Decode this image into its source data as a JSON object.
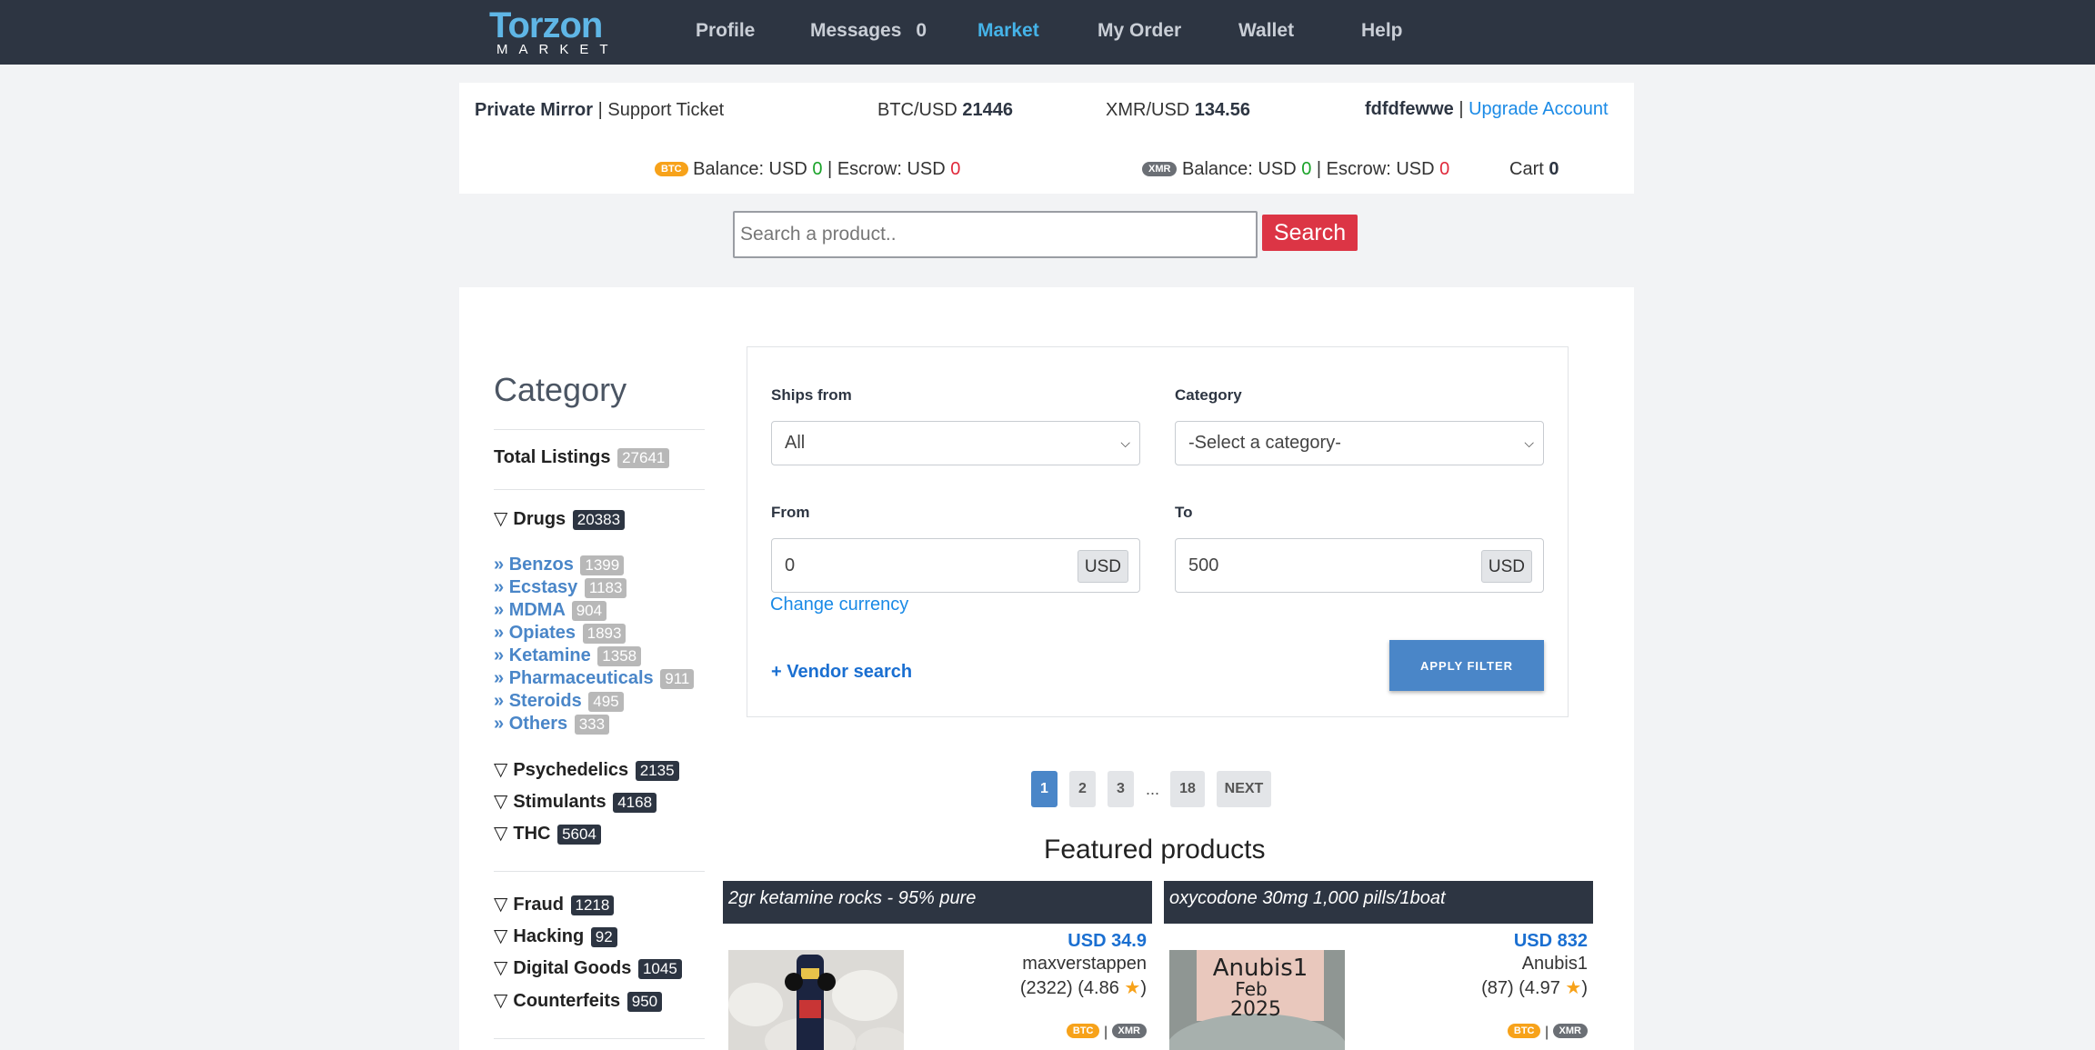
{
  "nav": {
    "logo_main": "Torzon",
    "logo_sub": "MARKET",
    "items": [
      {
        "label": "Profile"
      },
      {
        "label": "Messages"
      },
      {
        "label": "Market"
      },
      {
        "label": "My Order"
      },
      {
        "label": "Wallet"
      },
      {
        "label": "Help"
      }
    ],
    "messages_count": "0",
    "active_color": "#45b3e8"
  },
  "header": {
    "private_mirror": "Private Mirror",
    "separator": "|",
    "support_ticket": "Support Ticket",
    "btc_label": "BTC/USD",
    "btc_value": "21446",
    "xmr_label": "XMR/USD",
    "xmr_value": "134.56",
    "username": "fdfdfewwe",
    "upgrade": "Upgrade Account",
    "btc_badge": "BTC",
    "xmr_badge": "XMR",
    "balance_label": "Balance: USD",
    "escrow_label": "Escrow: USD",
    "btc_balance": "0",
    "btc_escrow": "0",
    "xmr_balance": "0",
    "xmr_escrow": "0",
    "cart_label": "Cart",
    "cart_count": "0"
  },
  "search": {
    "placeholder": "Search a product..",
    "button": "Search"
  },
  "sidebar": {
    "title": "Category",
    "total_label": "Total Listings",
    "total_count": "27641",
    "triangle": "▽",
    "subarrow": "»",
    "drugs": {
      "label": "Drugs",
      "count": "20383"
    },
    "drug_subs": [
      {
        "label": "Benzos",
        "count": "1399"
      },
      {
        "label": "Ecstasy",
        "count": "1183"
      },
      {
        "label": "MDMA",
        "count": "904"
      },
      {
        "label": "Opiates",
        "count": "1893"
      },
      {
        "label": "Ketamine",
        "count": "1358"
      },
      {
        "label": "Pharmaceuticals",
        "count": "911"
      },
      {
        "label": "Steroids",
        "count": "495"
      },
      {
        "label": "Others",
        "count": "333"
      }
    ],
    "group2": [
      {
        "label": "Psychedelics",
        "count": "2135"
      },
      {
        "label": "Stimulants",
        "count": "4168"
      },
      {
        "label": "THC",
        "count": "5604"
      }
    ],
    "group3": [
      {
        "label": "Fraud",
        "count": "1218"
      },
      {
        "label": "Hacking",
        "count": "92"
      },
      {
        "label": "Digital Goods",
        "count": "1045"
      },
      {
        "label": "Counterfeits",
        "count": "950"
      }
    ]
  },
  "filter": {
    "ships_from_label": "Ships from",
    "ships_from_value": "All",
    "category_label": "Category",
    "category_value": "-Select a category-",
    "from_label": "From",
    "from_value": "0",
    "to_label": "To",
    "to_value": "500",
    "unit": "USD",
    "change_currency": "Change currency",
    "vendor_search": "+ Vendor search",
    "apply": "APPLY FILTER"
  },
  "pagination": {
    "pages": [
      "1",
      "2",
      "3",
      "18"
    ],
    "dots": "...",
    "next": "NEXT",
    "current": "1"
  },
  "featured": {
    "title": "Featured products",
    "products": [
      {
        "title": "2gr ketamine rocks - 95% pure",
        "price": "USD 34.9",
        "vendor": "maxverstappen",
        "rating_prefix": "(2322) (4.86",
        "rating_suffix": ")"
      },
      {
        "title": "oxycodone 30mg 1,000 pills/1boat",
        "price": "USD 832",
        "vendor": "Anubis1",
        "rating_prefix": "(87) (4.97",
        "rating_suffix": ")",
        "image_text_1": "Anubis1",
        "image_text_2": "Feb",
        "image_text_3": "2025"
      }
    ],
    "star": "★",
    "btc_badge": "BTC",
    "xmr_badge": "XMR",
    "pipe": "|"
  }
}
